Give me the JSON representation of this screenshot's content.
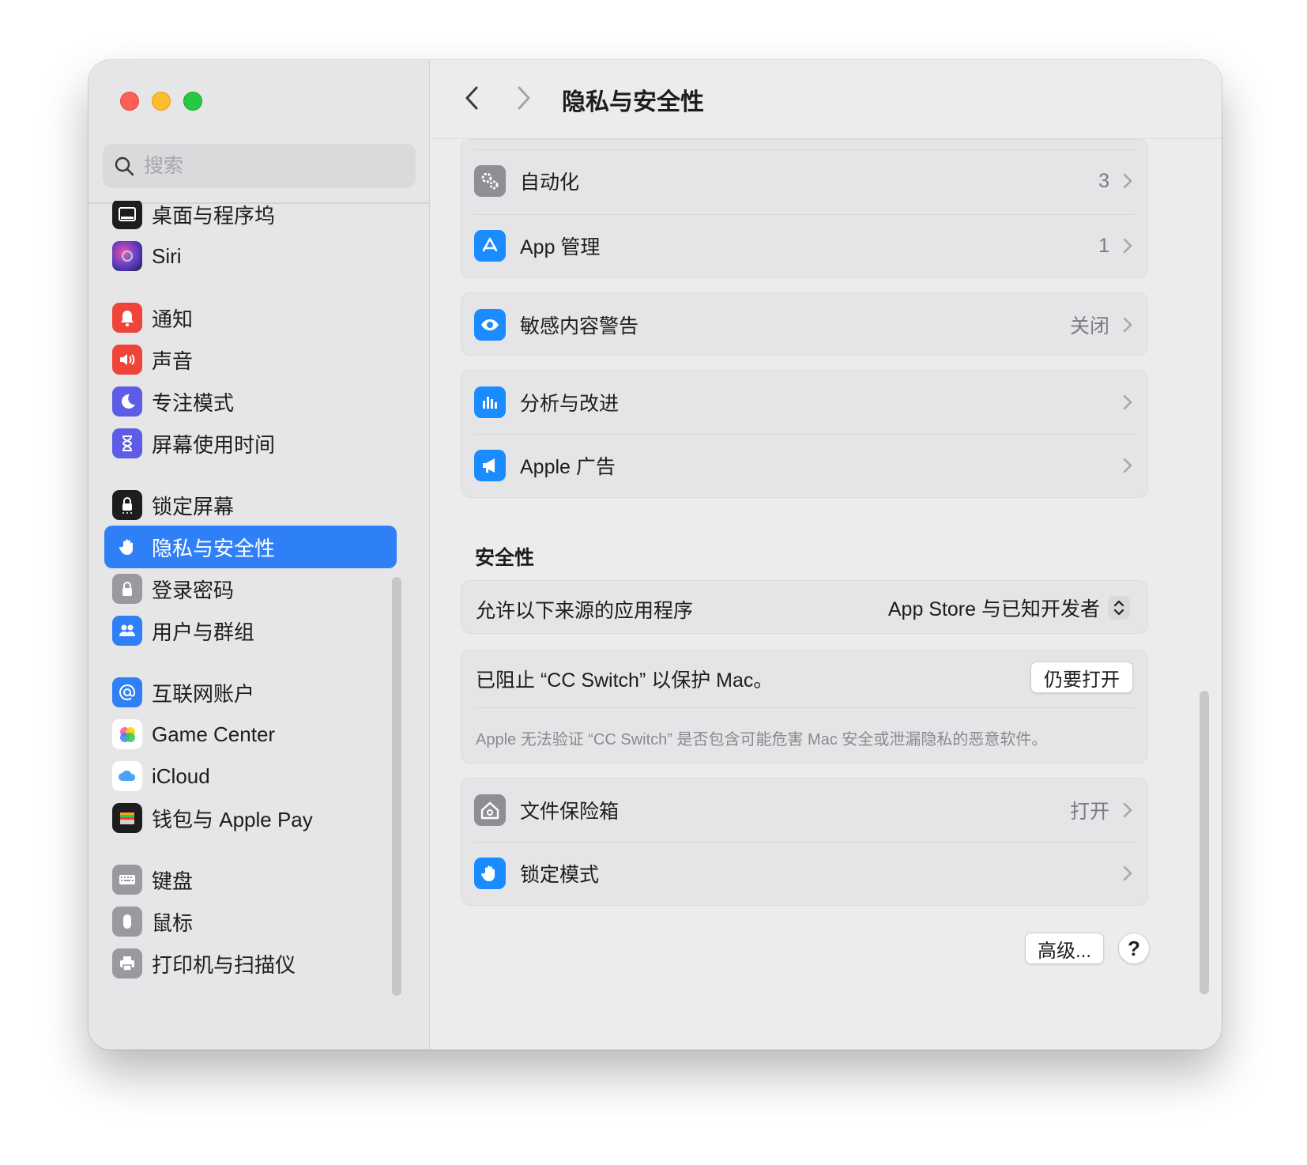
{
  "window": {
    "title": "隐私与安全性"
  },
  "search": {
    "placeholder": "搜索"
  },
  "sidebar": {
    "items": [
      {
        "label": "桌面与程序坞",
        "icon": "dock-icon",
        "color": "#1d1d1f"
      },
      {
        "label": "Siri",
        "icon": "siri-icon",
        "color": "#5b3cc4"
      },
      {
        "label": "通知",
        "icon": "bell-icon",
        "color": "#f0443a"
      },
      {
        "label": "声音",
        "icon": "speaker-icon",
        "color": "#f0443a"
      },
      {
        "label": "专注模式",
        "icon": "moon-icon",
        "color": "#5e5ce6"
      },
      {
        "label": "屏幕使用时间",
        "icon": "hourglass-icon",
        "color": "#5e5ce6"
      },
      {
        "label": "锁定屏幕",
        "icon": "lock-screen-icon",
        "color": "#1d1d1f"
      },
      {
        "label": "隐私与安全性",
        "icon": "hand-icon",
        "color": "#2f80f6",
        "active": true
      },
      {
        "label": "登录密码",
        "icon": "padlock-icon",
        "color": "#9a9a9e"
      },
      {
        "label": "用户与群组",
        "icon": "users-icon",
        "color": "#2f80f6"
      },
      {
        "label": "互联网账户",
        "icon": "at-icon",
        "color": "#2f80f6"
      },
      {
        "label": "Game Center",
        "icon": "game-center-icon",
        "color": "#ffffff"
      },
      {
        "label": "iCloud",
        "icon": "cloud-icon",
        "color": "#ffffff"
      },
      {
        "label": "钱包与 Apple Pay",
        "icon": "wallet-icon",
        "color": "#1d1d1f"
      },
      {
        "label": "键盘",
        "icon": "keyboard-icon",
        "color": "#9a9a9e"
      },
      {
        "label": "鼠标",
        "icon": "mouse-icon",
        "color": "#9a9a9e"
      },
      {
        "label": "打印机与扫描仪",
        "icon": "printer-icon",
        "color": "#9a9a9e"
      }
    ]
  },
  "privacy": {
    "automation": {
      "label": "自动化",
      "value": "3"
    },
    "app_management": {
      "label": "App 管理",
      "value": "1"
    },
    "sensitive_content": {
      "label": "敏感内容警告",
      "value": "关闭"
    },
    "analytics": {
      "label": "分析与改进"
    },
    "apple_ads": {
      "label": "Apple 广告"
    }
  },
  "security": {
    "section_title": "安全性",
    "allow_apps_label": "允许以下来源的应用程序",
    "allow_apps_value": "App Store 与已知开发者",
    "blocked_text": "已阻止 “CC Switch” 以保护 Mac。",
    "open_anyway_label": "仍要打开",
    "blocked_note": "Apple 无法验证 “CC Switch” 是否包含可能危害 Mac 安全或泄漏隐私的恶意软件。",
    "filevault": {
      "label": "文件保险箱",
      "value": "打开"
    },
    "lockdown": {
      "label": "锁定模式"
    }
  },
  "footer": {
    "advanced_label": "高级...",
    "help_label": "?"
  },
  "colors": {
    "accent": "#2f80f6",
    "close": "#fe5f57",
    "minimize": "#febc2e",
    "maximize": "#28c840"
  }
}
